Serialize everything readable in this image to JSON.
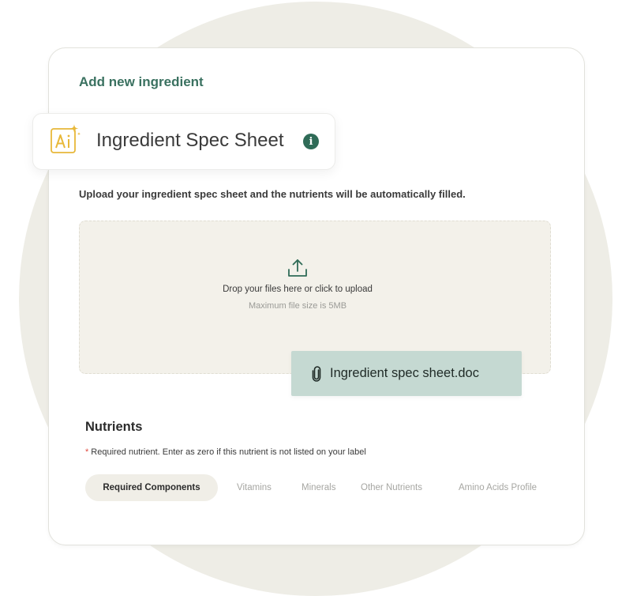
{
  "form": {
    "title": "Add new ingredient"
  },
  "spec_sheet": {
    "title": "Ingredient Spec Sheet",
    "ai_icon": "ai-sparkle-icon",
    "info_icon": "info-icon",
    "description": "Upload your ingredient spec sheet and the nutrients will be automatically filled."
  },
  "upload": {
    "icon": "upload-icon",
    "instruction": "Drop your files here or click to upload",
    "limit": "Maximum file size is 5MB",
    "file": {
      "icon": "paperclip-icon",
      "name": "Ingredient spec sheet.doc"
    }
  },
  "nutrients": {
    "title": "Nutrients",
    "required_marker": "*",
    "required_note": "Required nutrient. Enter as zero if this nutrient is not listed on your label",
    "tabs": [
      {
        "label": "Required Components",
        "active": true
      },
      {
        "label": "Vitamins",
        "active": false
      },
      {
        "label": "Minerals",
        "active": false
      },
      {
        "label": "Other Nutrients",
        "active": false
      },
      {
        "label": "Amino Acids Profile",
        "active": false
      }
    ]
  },
  "colors": {
    "accent": "#3a7160",
    "info": "#2f6b57",
    "ai_icon": "#e8b83a",
    "file_chip": "#c5d9d2",
    "dropzone": "#f3f1ea",
    "required_star": "#e04a3f"
  }
}
